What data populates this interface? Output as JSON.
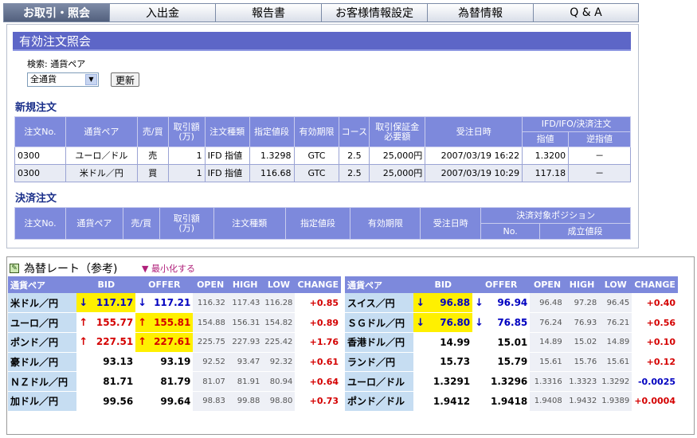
{
  "tabs": [
    "お取引・照会",
    "入出金",
    "報告書",
    "お客様情報設定",
    "為替情報",
    "Q & A"
  ],
  "page_title": "有効注文照会",
  "search": {
    "label": "検索: 通貨ペア",
    "selected": "全通貨",
    "button": "更新"
  },
  "new_orders": {
    "title": "新規注文",
    "headers": [
      "注文No.",
      "通貨ペア",
      "売/買",
      "取引額\n(万)",
      "注文種類",
      "指定値段",
      "有効期限",
      "コース",
      "取引保証金\n必要額",
      "受注日時",
      "IFD/IFO/決済注文"
    ],
    "subheaders": [
      "指値",
      "逆指値"
    ],
    "rows": [
      [
        "0300",
        "ユーロ／ドル",
        "売",
        "1",
        "IFD 指値",
        "1.3298",
        "GTC",
        "2.5",
        "25,000円",
        "2007/03/19 16:22",
        "1.3200",
        "－"
      ],
      [
        "0300",
        "米ドル／円",
        "買",
        "1",
        "IFD 指値",
        "116.68",
        "GTC",
        "2.5",
        "25,000円",
        "2007/03/19 10:29",
        "117.18",
        "－"
      ]
    ]
  },
  "settle_orders": {
    "title": "決済注文",
    "headers": [
      "注文No.",
      "通貨ペア",
      "売/買",
      "取引額\n(万)",
      "注文種類",
      "指定値段",
      "有効期限",
      "受注日時",
      "決済対象ポジション"
    ],
    "subheaders": [
      "No.",
      "成立値段"
    ]
  },
  "rates": {
    "title": "為替レート（参考)",
    "minimize": "▼ 最小化する",
    "headers": [
      "通貨ペア",
      "BID",
      "OFFER",
      "OPEN",
      "HIGH",
      "LOW",
      "CHANGE"
    ],
    "left": [
      {
        "pair": "米ドル／円",
        "bid": "117.17",
        "offer": "117.21",
        "open": "116.32",
        "high": "117.43",
        "low": "116.28",
        "change": "+0.85",
        "bid_arrow": "↓",
        "offer_arrow": "↓",
        "bid_hl": true,
        "offer_hl": false
      },
      {
        "pair": "ユーロ／円",
        "bid": "155.77",
        "offer": "155.81",
        "open": "154.88",
        "high": "156.31",
        "low": "154.82",
        "change": "+0.89",
        "bid_arrow": "↑",
        "offer_arrow": "↑",
        "bid_hl": false,
        "offer_hl": true
      },
      {
        "pair": "ポンド／円",
        "bid": "227.51",
        "offer": "227.61",
        "open": "225.75",
        "high": "227.93",
        "low": "225.42",
        "change": "+1.76",
        "bid_arrow": "↑",
        "offer_arrow": "↑",
        "bid_hl": false,
        "offer_hl": true
      },
      {
        "pair": "豪ドル／円",
        "bid": "93.13",
        "offer": "93.19",
        "open": "92.52",
        "high": "93.47",
        "low": "92.32",
        "change": "+0.61",
        "bid_arrow": "",
        "offer_arrow": "",
        "bid_hl": false,
        "offer_hl": false
      },
      {
        "pair": "ＮＺドル／円",
        "bid": "81.71",
        "offer": "81.79",
        "open": "81.07",
        "high": "81.91",
        "low": "80.94",
        "change": "+0.64",
        "bid_arrow": "",
        "offer_arrow": "",
        "bid_hl": false,
        "offer_hl": false
      },
      {
        "pair": "加ドル／円",
        "bid": "99.56",
        "offer": "99.64",
        "open": "98.83",
        "high": "99.88",
        "low": "98.80",
        "change": "+0.73",
        "bid_arrow": "",
        "offer_arrow": "",
        "bid_hl": false,
        "offer_hl": false
      }
    ],
    "right": [
      {
        "pair": "スイス／円",
        "bid": "96.88",
        "offer": "96.94",
        "open": "96.48",
        "high": "97.28",
        "low": "96.45",
        "change": "+0.40",
        "bid_arrow": "↓",
        "offer_arrow": "↓",
        "bid_hl": true,
        "offer_hl": false
      },
      {
        "pair": "ＳＧドル／円",
        "bid": "76.80",
        "offer": "76.85",
        "open": "76.24",
        "high": "76.93",
        "low": "76.21",
        "change": "+0.56",
        "bid_arrow": "↓",
        "offer_arrow": "↓",
        "bid_hl": true,
        "offer_hl": false
      },
      {
        "pair": "香港ドル／円",
        "bid": "14.99",
        "offer": "15.01",
        "open": "14.89",
        "high": "15.02",
        "low": "14.89",
        "change": "+0.10",
        "bid_arrow": "",
        "offer_arrow": "",
        "bid_hl": false,
        "offer_hl": false
      },
      {
        "pair": "ランド／円",
        "bid": "15.73",
        "offer": "15.79",
        "open": "15.61",
        "high": "15.76",
        "low": "15.61",
        "change": "+0.12",
        "bid_arrow": "",
        "offer_arrow": "",
        "bid_hl": false,
        "offer_hl": false
      },
      {
        "pair": "ユーロ／ドル",
        "bid": "1.3291",
        "offer": "1.3296",
        "open": "1.3316",
        "high": "1.3323",
        "low": "1.3292",
        "change": "-0.0025",
        "bid_arrow": "",
        "offer_arrow": "",
        "bid_hl": false,
        "offer_hl": false
      },
      {
        "pair": "ポンド／ドル",
        "bid": "1.9412",
        "offer": "1.9418",
        "open": "1.9408",
        "high": "1.9432",
        "low": "1.9389",
        "change": "+0.0004",
        "bid_arrow": "",
        "offer_arrow": "",
        "bid_hl": false,
        "offer_hl": false
      }
    ]
  },
  "colors": {
    "header": "#7d89dc",
    "title_bar": "#5d66c7",
    "highlight": "#fff000",
    "up": "#d40000",
    "down": "#0000c0"
  }
}
